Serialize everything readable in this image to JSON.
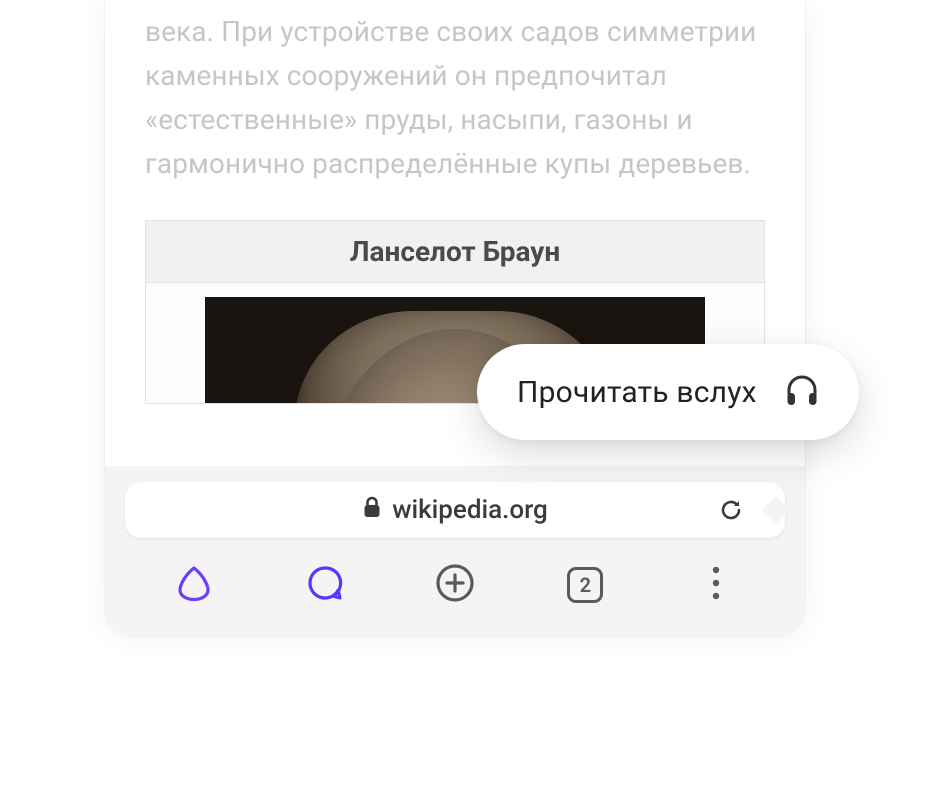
{
  "article": {
    "visible_text": "века. При устройстве своих садов симметрии каменных сооружений он предпочитал «естественные» пруды, насыпи, газоны и гармонично распределённые купы деревьев."
  },
  "infobox": {
    "title": "Ланселот Браун"
  },
  "floating_action": {
    "label": "Прочитать вслух"
  },
  "address_bar": {
    "domain": "wikipedia.org"
  },
  "nav": {
    "tab_count": "2"
  }
}
